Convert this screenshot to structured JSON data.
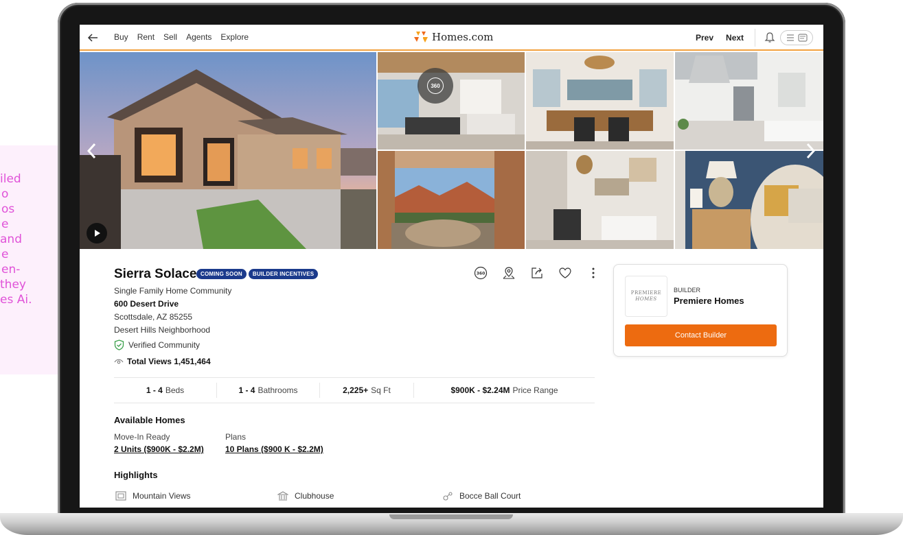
{
  "callout": {
    "lines": [
      "iled",
      "o",
      "os",
      "e",
      "and",
      "e",
      "en-",
      "they",
      "es Ai."
    ]
  },
  "nav": {
    "links": [
      "Buy",
      "Rent",
      "Sell",
      "Agents",
      "Explore"
    ],
    "logo_text": "Homes.com",
    "prev": "Prev",
    "next": "Next"
  },
  "listing": {
    "name": "Sierra Solace",
    "tags": [
      "COMING SOON",
      "BUILDER INCENTIVES"
    ],
    "type": "Single Family Home Community",
    "address": "600 Desert Drive",
    "city": "Scottsdale, AZ  85255",
    "neighborhood": "Desert Hills Neighborhood",
    "verified": "Verified Community",
    "views": "Total Views 1,451,464"
  },
  "stats": [
    {
      "value": "1 - 4",
      "label": "Beds"
    },
    {
      "value": "1 - 4",
      "label": "Bathrooms"
    },
    {
      "value": "2,225+",
      "label": "Sq Ft"
    },
    {
      "value": "$900K - $2.24M",
      "label": "Price Range"
    }
  ],
  "available": {
    "title": "Available Homes",
    "move_in_label": "Move-In Ready",
    "move_in_link": "2 Units ($900K - $2.2M)",
    "plans_label": "Plans",
    "plans_link": "10 Plans ($900 K - $2.2M)"
  },
  "highlights": {
    "title": "Highlights",
    "items": [
      "Mountain Views",
      "Clubhouse",
      "Bocce Ball Court"
    ]
  },
  "builder": {
    "logo_line1": "PREMIERE",
    "logo_line2": "HOMES",
    "kicker": "BUILDER",
    "name": "Premiere Homes",
    "cta": "Contact Builder"
  },
  "gallery": {
    "badge_360": "360"
  },
  "colors": {
    "accent_orange": "#ed6b10",
    "nav_underline": "#f2a13e",
    "tag_blue": "#1b3a8c",
    "callout_pink": "#e052d8"
  }
}
